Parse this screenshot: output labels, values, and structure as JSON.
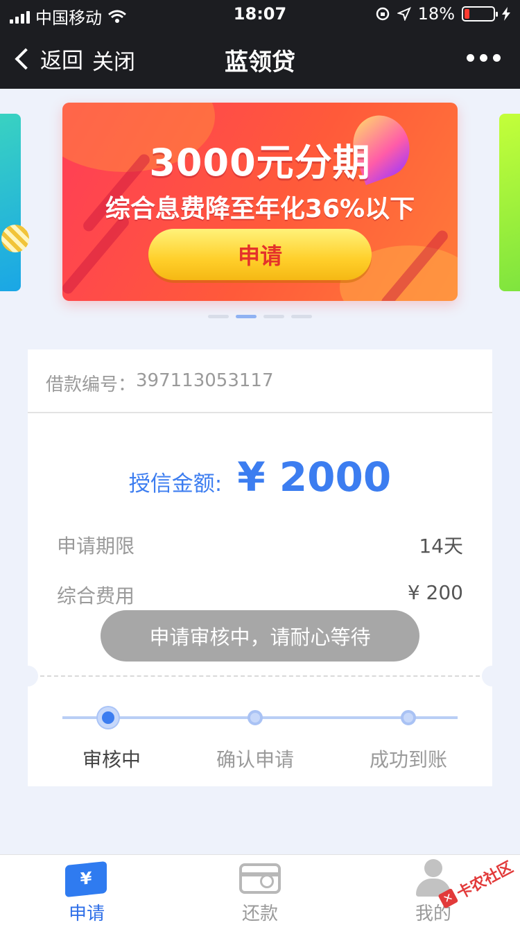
{
  "status_bar": {
    "carrier": "中国移动",
    "time": "18:07",
    "battery": "18%",
    "battery_level": 0.18
  },
  "nav": {
    "back_label": "返回",
    "close_label": "关闭",
    "title": "蓝领贷"
  },
  "banner": {
    "headline": "3000元分期",
    "subline": "综合息费降至年化36%以下",
    "button_label": "申请",
    "page_count": 4,
    "active_index": 1
  },
  "loan": {
    "number_label": "借款编号：",
    "number": "397113053117",
    "credit_label": "授信金额:",
    "credit_amount": "¥ 2000",
    "term_label": "申请期限",
    "term_value": "14天",
    "fee_label": "综合费用",
    "fee_value": "¥ 200"
  },
  "toast": "申请审核中，请耐心等待",
  "progress": {
    "current_index": 0,
    "steps": [
      "审核中",
      "确认申请",
      "成功到账"
    ]
  },
  "tabbar": {
    "items": [
      {
        "label": "申请",
        "icon": "apply-ticket-icon",
        "active": true
      },
      {
        "label": "还款",
        "icon": "card-icon",
        "active": false
      },
      {
        "label": "我的",
        "icon": "user-icon",
        "active": false
      }
    ]
  },
  "watermark": "卡农社区",
  "colors": {
    "accent": "#3c7df0",
    "header_bg": "#1c1d21",
    "page_bg": "#eef2fb",
    "battery_low": "#ff3b30"
  }
}
